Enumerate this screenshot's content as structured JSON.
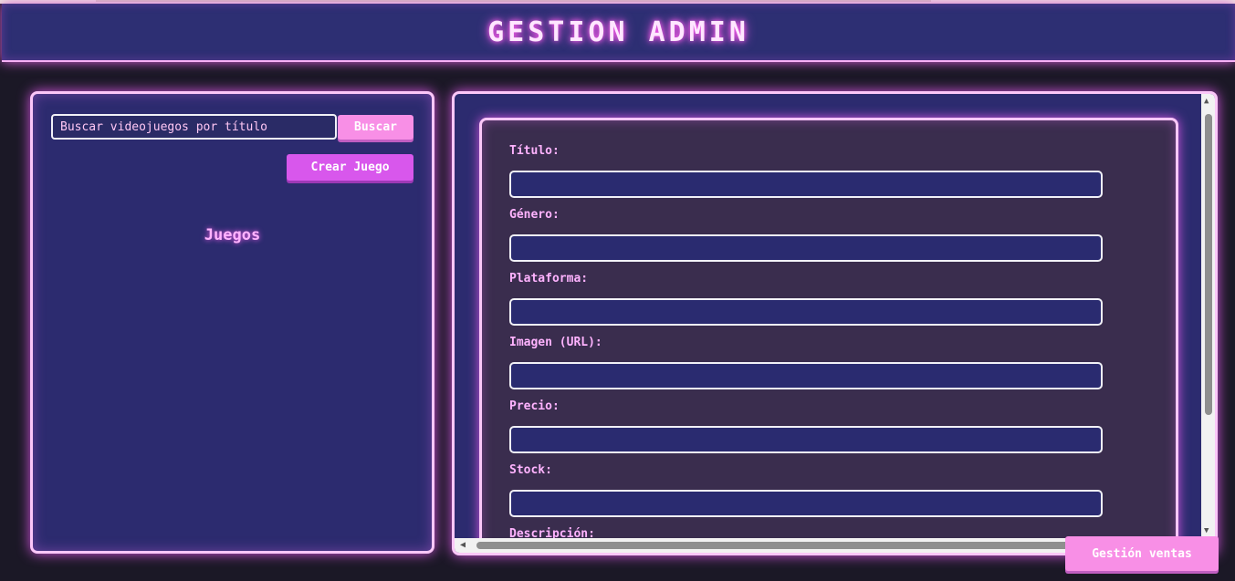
{
  "header": {
    "title": "GESTION ADMIN"
  },
  "sidebar": {
    "search_placeholder": "Buscar videojuegos por título",
    "search_button": "Buscar",
    "create_button": "Crear Juego",
    "list_heading": "Juegos"
  },
  "form": {
    "fields": [
      {
        "label": "Título:",
        "value": ""
      },
      {
        "label": "Género:",
        "value": ""
      },
      {
        "label": "Plataforma:",
        "value": ""
      },
      {
        "label": "Imagen (URL):",
        "value": ""
      },
      {
        "label": "Precio:",
        "value": ""
      },
      {
        "label": "Stock:",
        "value": ""
      },
      {
        "label": "Descripción:",
        "value": ""
      }
    ]
  },
  "footer": {
    "sales_button": "Gestión ventas"
  },
  "colors": {
    "background": "#1b1826",
    "panel": "#2c2b6f",
    "neon_border": "#fbc7f8",
    "accent_pink": "#f88fe6",
    "accent_purple": "#d857ec"
  }
}
